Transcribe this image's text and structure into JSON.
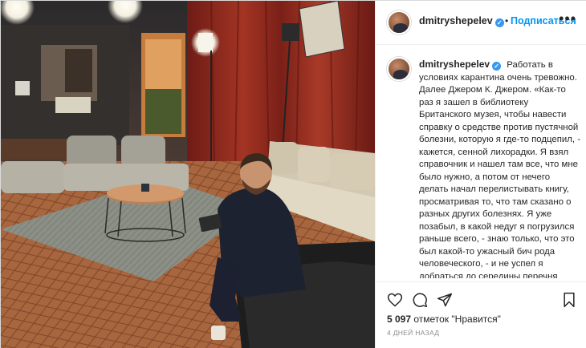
{
  "post": {
    "username": "dmitryshepelev",
    "follow_label": "Подписаться",
    "more_icon": "more-options-icon",
    "caption_text": "Работать в условиях карантина очень тревожно. Далее Джером К. Джером. «Как-то раз я зашел в библиотеку Британского музея, чтобы навести справку о средстве против пустячной болезни, которую я где-то подцепил, - кажется, сенной лихорадки. Я взял справочник и нашел там все, что мне было нужно, а потом от нечего делать начал перелистывать книгу, просматривая то, что там сказано о разных других болезнях. Я уже позабыл, в какой недуг я погрузился раньше всего, - знаю только, что это был какой-то ужасный бич рода человеческого, - и не успел я добраться до середины перечня \"ранних симптомов\", как",
    "likes_count": "5 097",
    "likes_suffix": " отметок \"Нравится\"",
    "time_ago": "4 дней назад",
    "accent_color": "#0095f6",
    "verified_color": "#3897f0"
  },
  "icons": {
    "like": "heart-icon",
    "comment": "comment-icon",
    "share": "share-icon",
    "save": "bookmark-icon"
  }
}
